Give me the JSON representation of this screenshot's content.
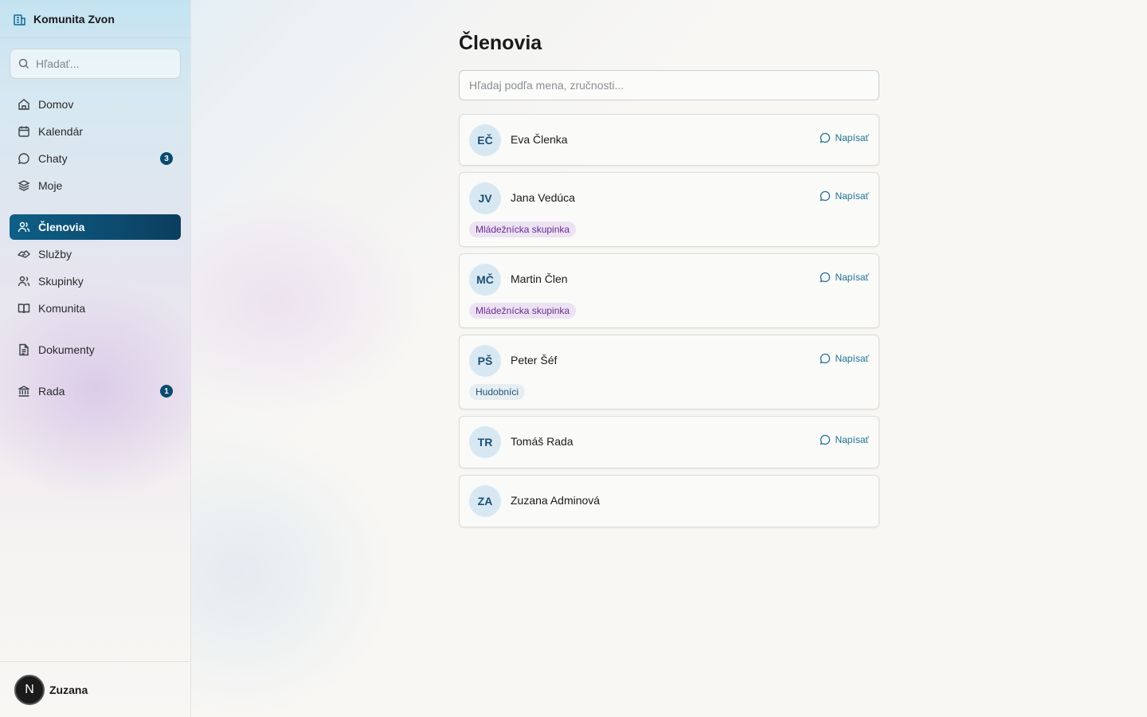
{
  "app": {
    "name": "Komunita Zvon"
  },
  "sidebar": {
    "search_placeholder": "Hľadať...",
    "items": [
      {
        "label": "Domov",
        "icon": "home-icon"
      },
      {
        "label": "Kalendár",
        "icon": "calendar-icon"
      },
      {
        "label": "Chaty",
        "icon": "chat-icon",
        "badge": "3"
      },
      {
        "label": "Moje",
        "icon": "layers-icon"
      },
      {
        "label": "Členovia",
        "icon": "users-icon",
        "active": true
      },
      {
        "label": "Služby",
        "icon": "handshake-icon"
      },
      {
        "label": "Skupinky",
        "icon": "group-icon"
      },
      {
        "label": "Komunita",
        "icon": "book-icon"
      },
      {
        "label": "Dokumenty",
        "icon": "document-icon"
      },
      {
        "label": "Rada",
        "icon": "bank-icon",
        "badge": "1"
      }
    ],
    "user": {
      "initial": "N",
      "name": "Zuzana"
    }
  },
  "main": {
    "title": "Členovia",
    "search_placeholder": "Hľadaj podľa mena, zručnosti...",
    "message_label": "Napísať",
    "members": [
      {
        "initials": "EČ",
        "name": "Eva Členka",
        "can_message": true,
        "tag": ""
      },
      {
        "initials": "JV",
        "name": "Jana Vedúca",
        "can_message": true,
        "tag": "Mládežnícka skupinka"
      },
      {
        "initials": "MČ",
        "name": "Martin Člen",
        "can_message": true,
        "tag": "Mládežnícka skupinka"
      },
      {
        "initials": "PŠ",
        "name": "Peter Šéf",
        "can_message": true,
        "tag": "Hudobníci"
      },
      {
        "initials": "TR",
        "name": "Tomáš Rada",
        "can_message": true,
        "tag": ""
      },
      {
        "initials": "ZA",
        "name": "Zuzana Adminová",
        "can_message": false,
        "tag": ""
      }
    ]
  },
  "colors": {
    "accent": "#0b4a6f",
    "link": "#1f6f96",
    "tag_purple_bg": "#ece3f2",
    "tag_purple_text": "#6a2d91",
    "tag_blue_bg": "#e6eef4",
    "tag_blue_text": "#1f5378"
  }
}
